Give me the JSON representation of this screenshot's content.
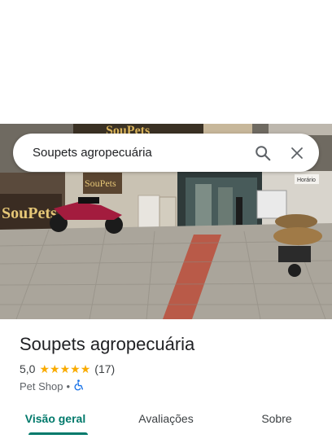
{
  "search": {
    "query": "Soupets agropecuária"
  },
  "photo": {
    "storefront_sign": "SouPets",
    "wall_sign": "SouPets",
    "hours_sign": "Horário"
  },
  "place": {
    "name": "Soupets agropecuária",
    "rating": "5,0",
    "stars": 5,
    "review_count": "(17)",
    "category": "Pet Shop",
    "separator": "•"
  },
  "tabs": [
    {
      "label": "Visão geral",
      "active": true
    },
    {
      "label": "Avaliações",
      "active": false
    },
    {
      "label": "Sobre",
      "active": false
    }
  ],
  "colors": {
    "accent": "#00796b",
    "star": "#f9ab00",
    "accessible": "#1a73e8"
  }
}
